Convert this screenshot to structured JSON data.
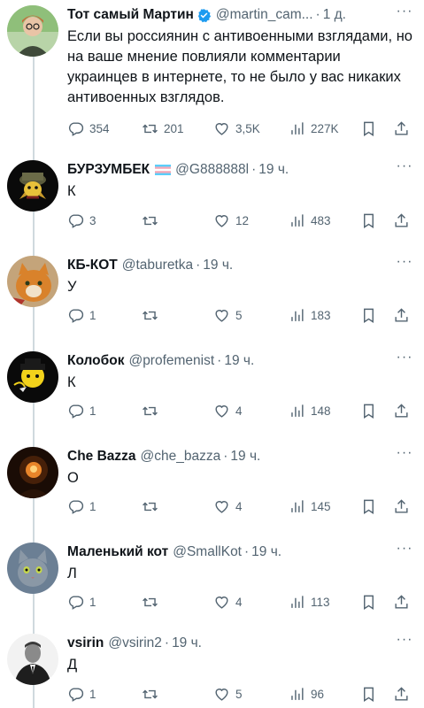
{
  "colors": {
    "text": "#0f1419",
    "muted": "#536471",
    "line": "#cfd9de",
    "verified": "#1d9bf0"
  },
  "icons": [
    "reply-icon",
    "retweet-icon",
    "like-icon",
    "views-icon",
    "bookmark-icon",
    "share-icon",
    "more-icon",
    "verified-badge-icon",
    "trans-flag-icon"
  ],
  "tweets": [
    {
      "name": "Тот самый Мартин",
      "handle": "@martin_cam...",
      "sep": "·",
      "time": "1 д.",
      "text": "Если вы россиянин с антивоенными взглядами, но на ваше мнение повлияли комментарии украинцев в интернете, то не было у вас никаких антивоенных взглядов.",
      "replies": "354",
      "retweets": "201",
      "likes": "3,5K",
      "views": "227K"
    },
    {
      "name": "БУРЗУМБЕК",
      "handle": "@G888888l",
      "sep": "·",
      "time": "19 ч.",
      "text": "К",
      "replies": "3",
      "retweets": "",
      "likes": "12",
      "views": "483"
    },
    {
      "name": "КБ-КОТ",
      "handle": "@taburetka",
      "sep": "·",
      "time": "19 ч.",
      "text": "У",
      "replies": "1",
      "retweets": "",
      "likes": "5",
      "views": "183"
    },
    {
      "name": "Колобок",
      "handle": "@profemenist",
      "sep": "·",
      "time": "19 ч.",
      "text": "К",
      "replies": "1",
      "retweets": "",
      "likes": "4",
      "views": "148"
    },
    {
      "name": "Che Bazza",
      "handle": "@che_bazza",
      "sep": "·",
      "time": "19 ч.",
      "text": "О",
      "replies": "1",
      "retweets": "",
      "likes": "4",
      "views": "145"
    },
    {
      "name": "Маленький кот",
      "handle": "@SmallKot",
      "sep": "·",
      "time": "19 ч.",
      "text": "Л",
      "replies": "1",
      "retweets": "",
      "likes": "4",
      "views": "113"
    },
    {
      "name": "vsirin",
      "handle": "@vsirin2",
      "sep": "·",
      "time": "19 ч.",
      "text": "Д",
      "replies": "1",
      "retweets": "",
      "likes": "5",
      "views": "96"
    }
  ]
}
